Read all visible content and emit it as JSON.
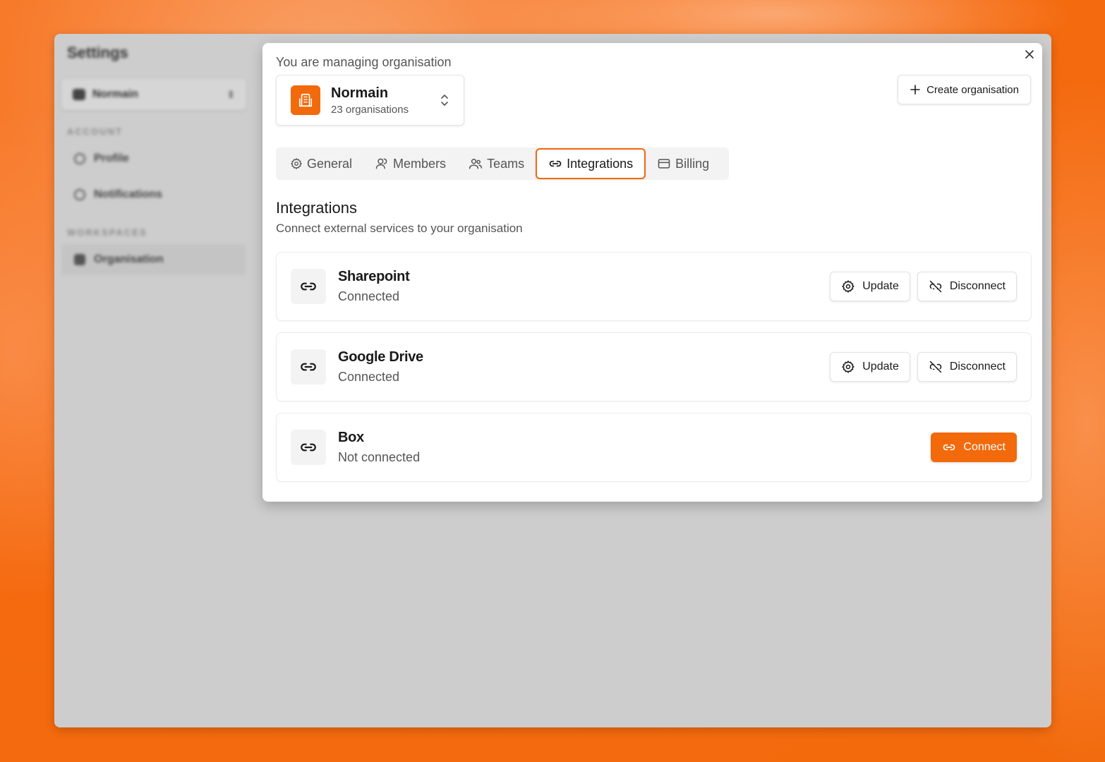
{
  "colors": {
    "accent": "#f26a0c",
    "background": "#f56a0f"
  },
  "settings": {
    "title": "Settings",
    "org_selector": "Normain",
    "account_label": "ACCOUNT",
    "workspaces_label": "WORKSPACES",
    "nav": [
      {
        "label": "Profile",
        "icon": "user-icon"
      },
      {
        "label": "Notifications",
        "icon": "bell-icon"
      },
      {
        "label": "Organisation",
        "icon": "building-icon",
        "active": true
      }
    ]
  },
  "modal": {
    "managing_label": "You are managing organisation",
    "org": {
      "name": "Normain",
      "count": "23 organisations"
    },
    "create_label": "Create organisation",
    "tabs": [
      {
        "label": "General",
        "icon": "gear-icon"
      },
      {
        "label": "Members",
        "icon": "user-icon"
      },
      {
        "label": "Teams",
        "icon": "users-icon"
      },
      {
        "label": "Integrations",
        "icon": "link-icon",
        "active": true
      },
      {
        "label": "Billing",
        "icon": "card-icon"
      }
    ],
    "section_title": "Integrations",
    "section_subtitle": "Connect external services to your organisation",
    "integrations": [
      {
        "name": "Sharepoint",
        "status": "Connected",
        "update_label": "Update",
        "disconnect_label": "Disconnect"
      },
      {
        "name": "Google Drive",
        "status": "Connected",
        "update_label": "Update",
        "disconnect_label": "Disconnect"
      },
      {
        "name": "Box",
        "status": "Not connected",
        "connect_label": "Connect"
      }
    ]
  }
}
